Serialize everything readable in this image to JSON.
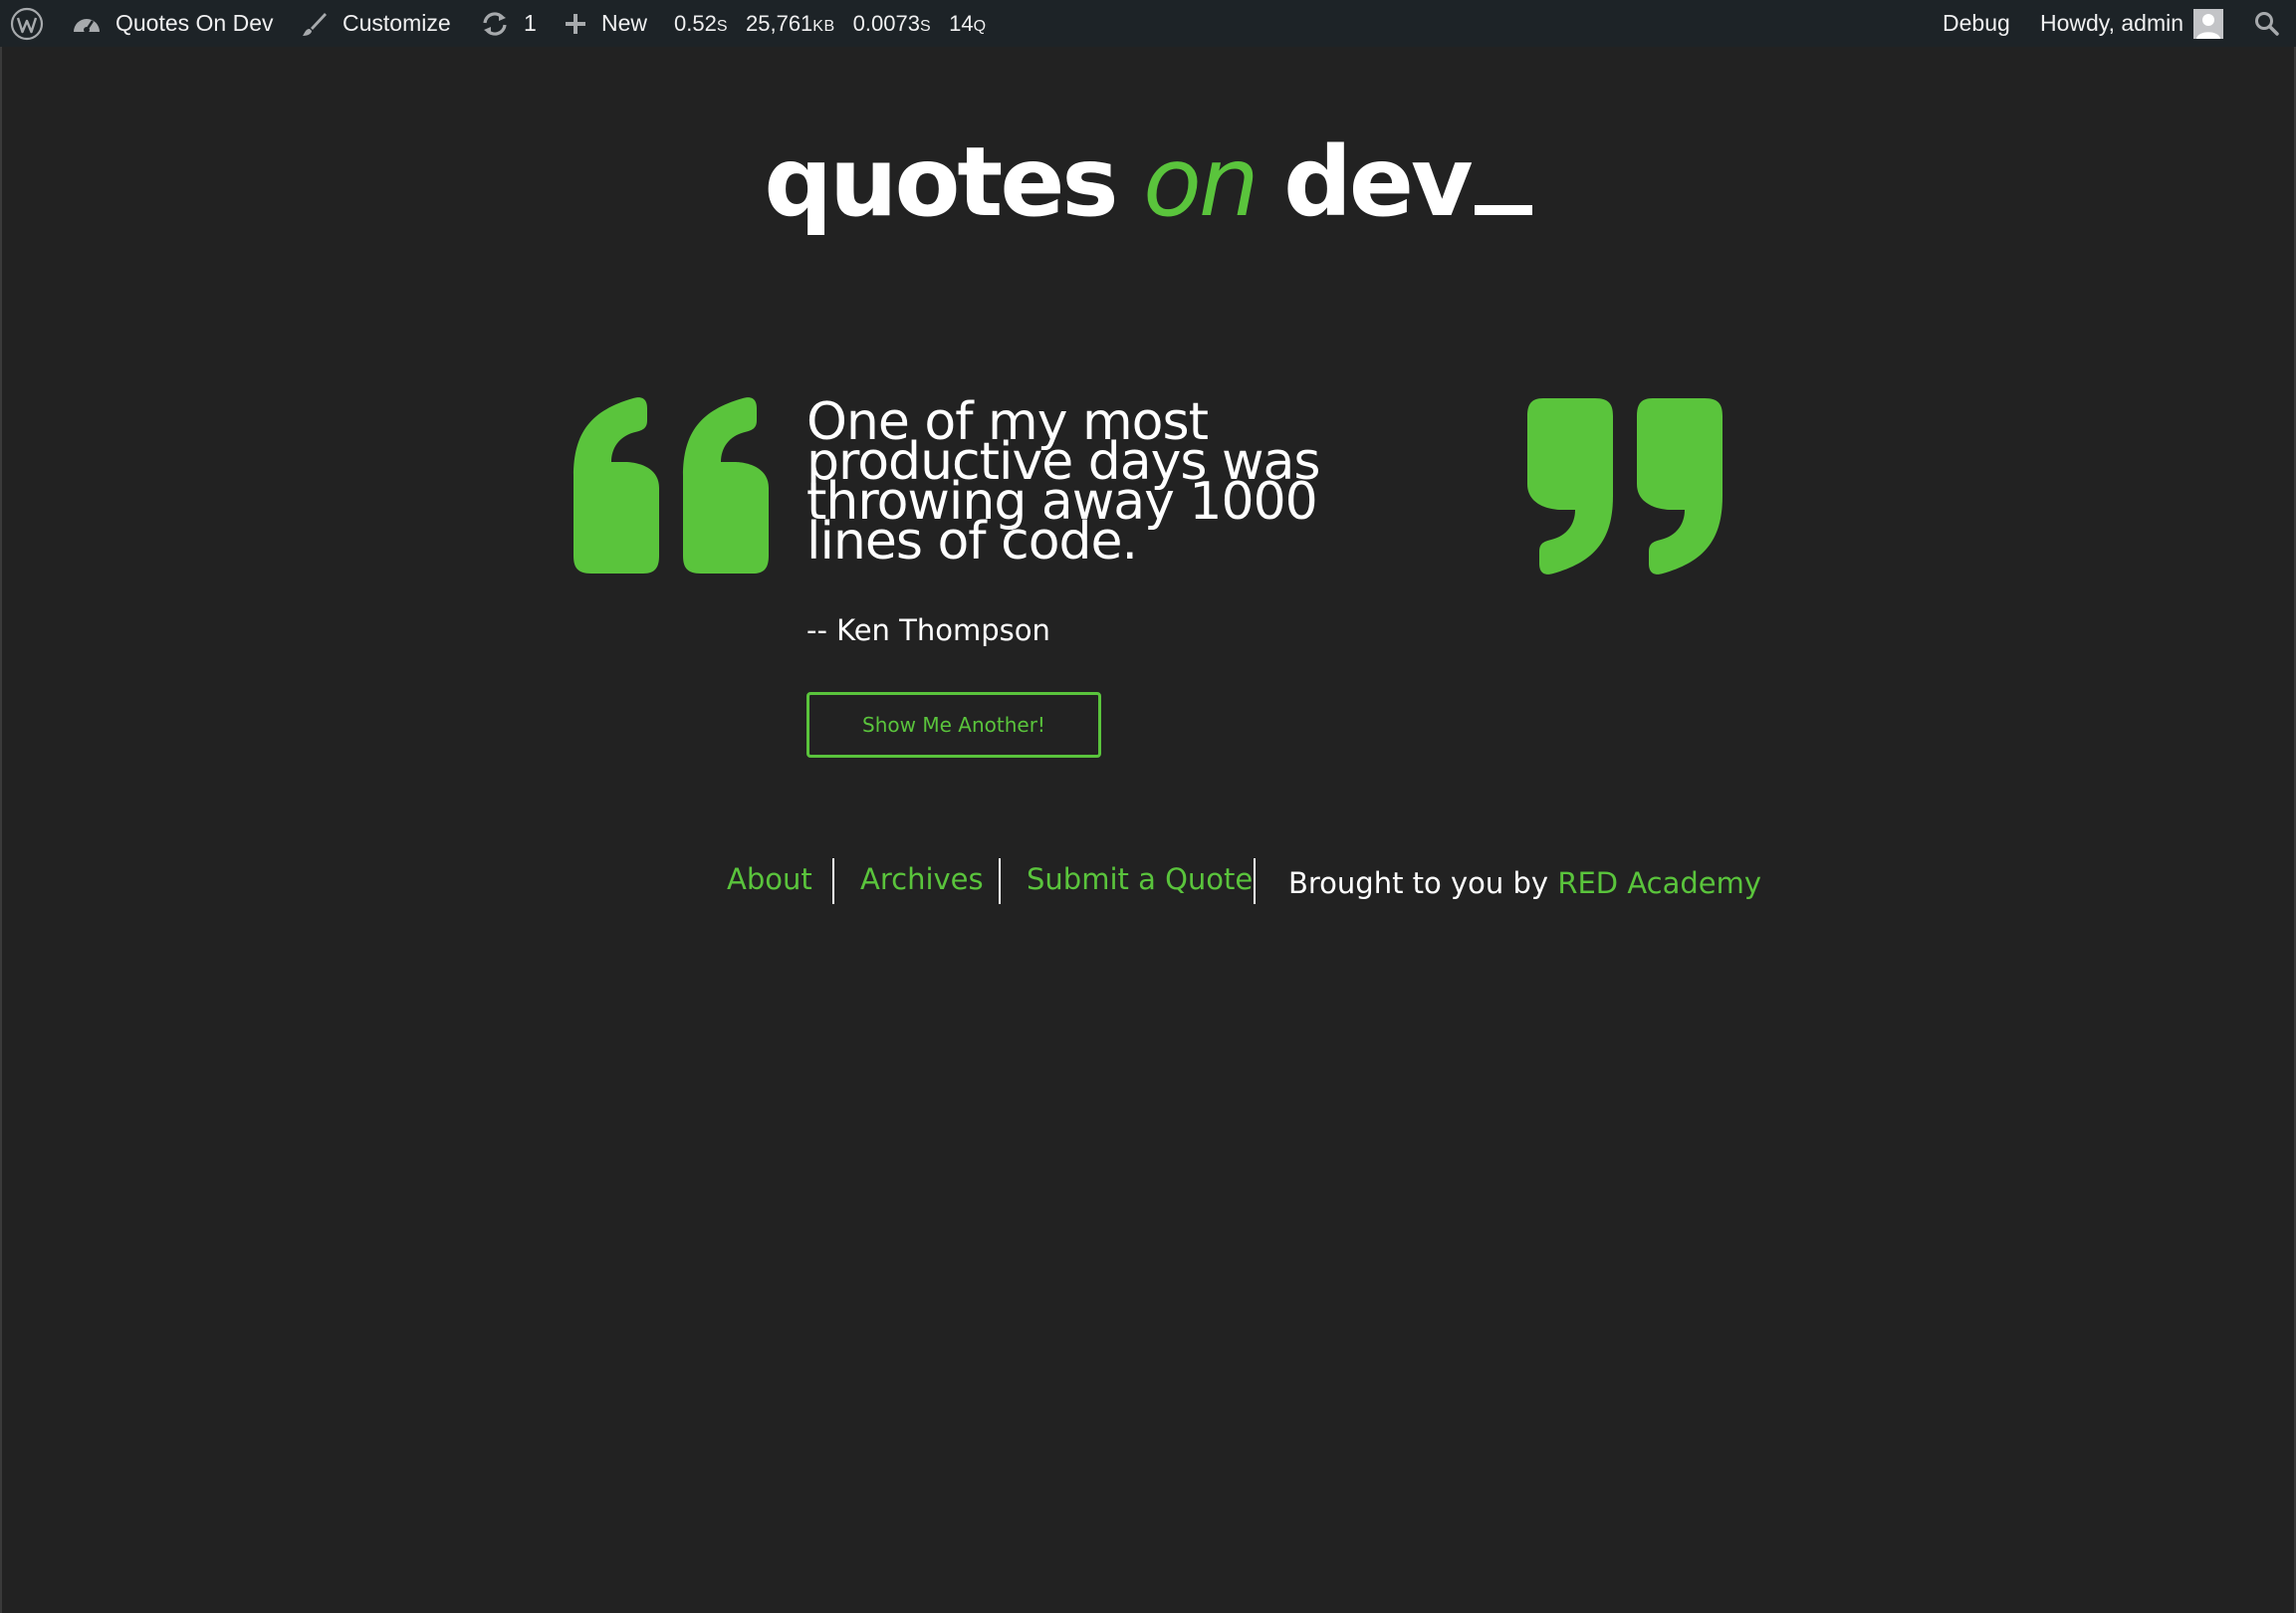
{
  "adminbar": {
    "site_name": "Quotes On Dev",
    "customize": "Customize",
    "updates_count": "1",
    "new_label": "New",
    "stat_time": "0.52",
    "stat_time_unit": "S",
    "stat_memory": "25,761",
    "stat_memory_unit": "KB",
    "stat_query_time": "0.0073",
    "stat_query_time_unit": "S",
    "stat_queries": "14",
    "stat_queries_unit": "Q",
    "debug": "Debug",
    "howdy": "Howdy, admin"
  },
  "logo": {
    "word1": "quotes",
    "word2": "on",
    "word3": "dev"
  },
  "quote": {
    "content": "One of my most productive days was throwing away 1000 lines of code.",
    "author": "-- Ken Thompson",
    "button_label": "Show Me Another!"
  },
  "footer": {
    "links": [
      "About",
      "Archives",
      "Submit a Quote"
    ],
    "credit_prefix": "Brought to you by",
    "credit_link": "RED Academy"
  },
  "colors": {
    "background": "#222222",
    "accent": "#5ac43c",
    "adminbar": "#1d2327"
  }
}
